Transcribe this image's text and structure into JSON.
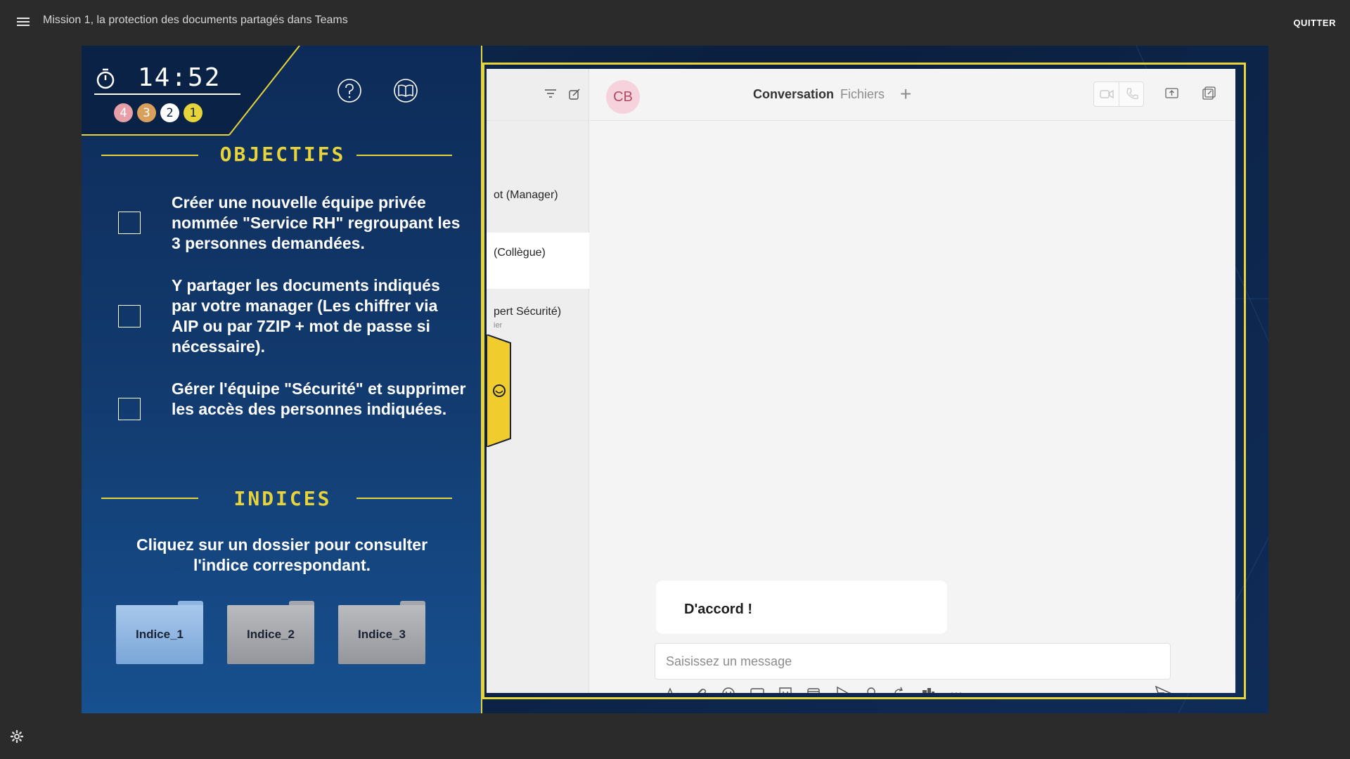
{
  "topbar": {
    "title": "Mission 1, la protection des documents partagés dans Teams",
    "quit_label": "QUITTER"
  },
  "panel": {
    "timer": "14:52",
    "coins": [
      "4",
      "3",
      "2",
      "1"
    ],
    "coin_colors": [
      "#e8a0a8",
      "#d9a05c",
      "#ffffff",
      "#e6d43a"
    ],
    "objectives_title": "OBJECTIFS",
    "objectives": [
      {
        "text": "Créer une nouvelle équipe privée nommée \"Service RH\" regroupant les 3 personnes demandées."
      },
      {
        "text": "Y partager les documents indiqués par votre manager (Les chiffrer via AIP ou par 7ZIP + mot de passe si nécessaire)."
      },
      {
        "text": "Gérer l'équipe \"Sécurité\" et supprimer les accès des personnes indiquées."
      }
    ],
    "hints_title": "INDICES",
    "hints_text": "Cliquez sur un dossier pour consulter l'indice correspondant.",
    "folders": [
      {
        "label": "Indice_1",
        "color": "#8fb6e2"
      },
      {
        "label": "Indice_2",
        "color": "#a4a6ab"
      },
      {
        "label": "Indice_3",
        "color": "#a4a6ab"
      }
    ]
  },
  "teams": {
    "contacts": [
      {
        "name": "ot (Manager)",
        "sub": ""
      },
      {
        "name": "(Collègue)",
        "sub": ""
      },
      {
        "name": "pert Sécurité)",
        "sub": "ier"
      }
    ],
    "avatar_initials": "CB",
    "tabs": {
      "conversation": "Conversation",
      "files": "Fichiers",
      "add": "+"
    },
    "message": "D'accord !",
    "input_placeholder": "Saisissez un message",
    "toolbar_icons": [
      "format-icon",
      "attach-icon",
      "emoji-icon",
      "gif-icon",
      "sticker-icon",
      "schedule-meeting-icon",
      "stream-icon",
      "praise-icon",
      "loop-icon",
      "apps-icon",
      "more-icon"
    ]
  },
  "colors": {
    "accent_yellow": "#e6d43a",
    "panel_blue": "#123a6e",
    "avatar_bg": "#f6d2dd"
  }
}
